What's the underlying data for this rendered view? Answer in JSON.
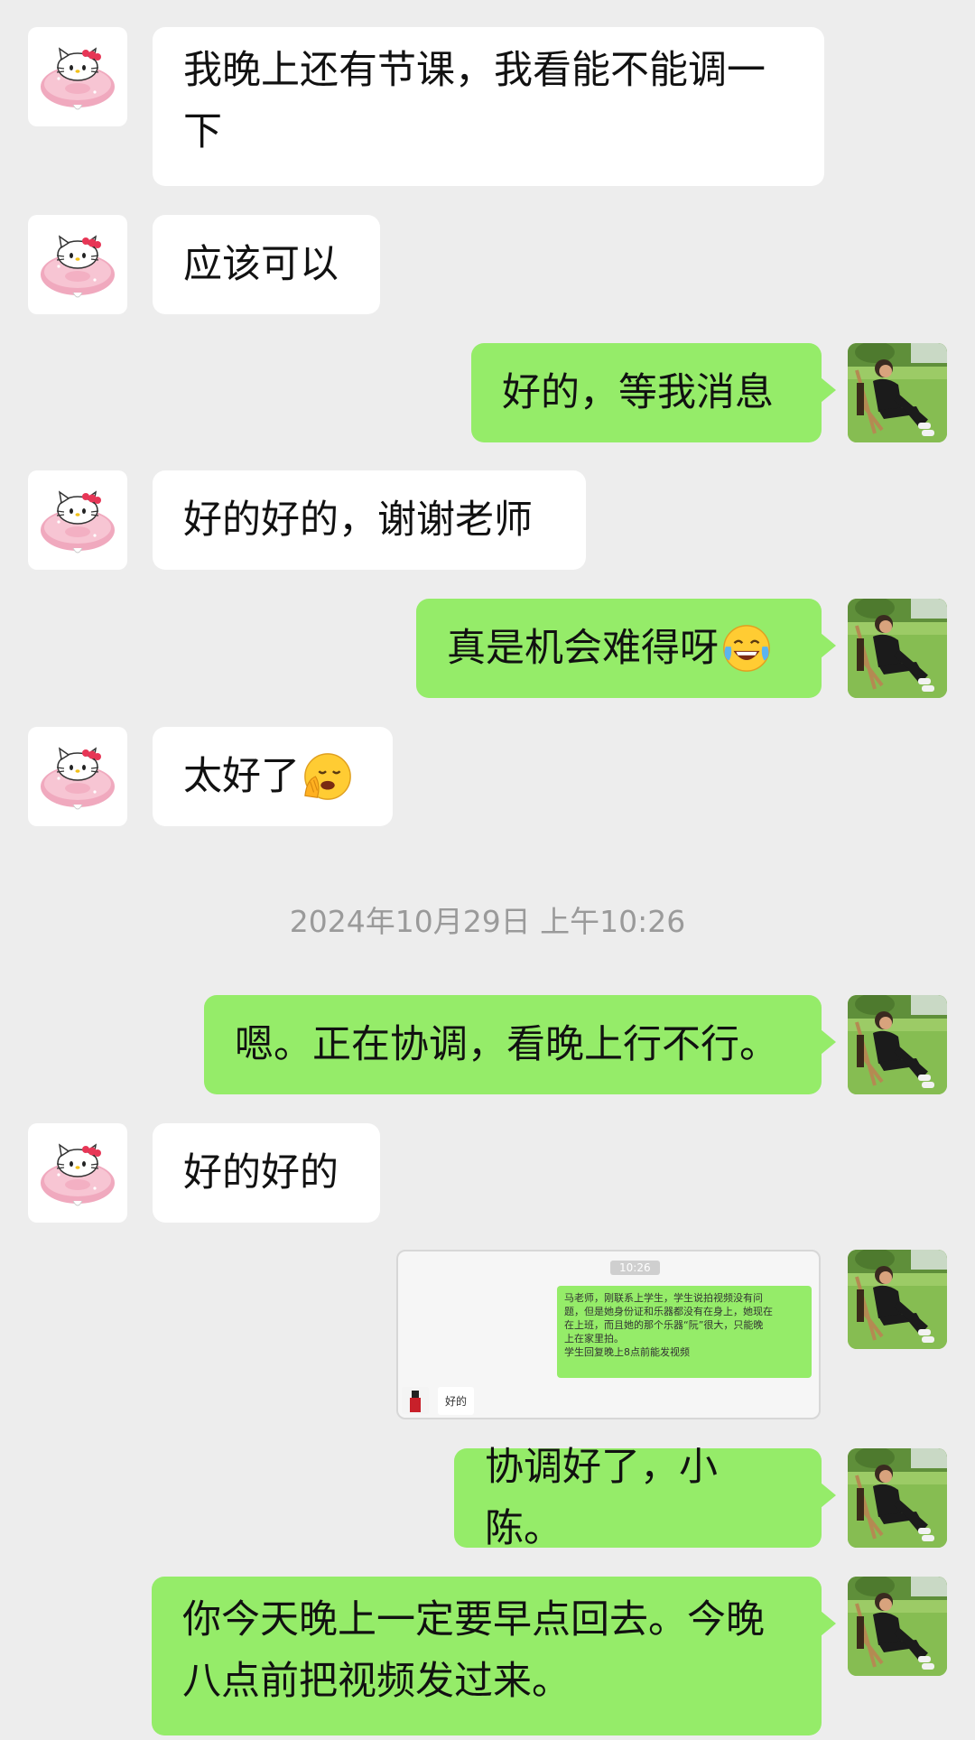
{
  "messages": [
    {
      "side": "left",
      "text_lines": [
        "我晚上还有节课，我看能不能调一",
        "下"
      ]
    },
    {
      "side": "left",
      "text": "应该可以"
    },
    {
      "side": "right",
      "text": "好的，等我消息"
    },
    {
      "side": "left",
      "text": "好的好的，谢谢老师"
    },
    {
      "side": "right",
      "text": "真是机会难得呀",
      "emoji": "tears-of-joy"
    },
    {
      "side": "left",
      "text": "太好了",
      "emoji": "face-in-hand"
    },
    {
      "timestamp": "2024年10月29日 上午10:26"
    },
    {
      "side": "right",
      "text": "嗯。正在协调，看晚上行不行。"
    },
    {
      "side": "left",
      "text": "好的好的"
    },
    {
      "side": "right",
      "type": "image",
      "screenshot": {
        "time": "10:26",
        "lines": [
          "马老师，刚联系上学生，学生说拍视频没有问",
          "题，但是她身份证和乐器都没有在身上，她现在",
          "在上班，而且她的那个乐器“阮”很大，只能晚",
          "上在家里拍。",
          "学生回复晚上8点前能发视频"
        ],
        "reply": "好的"
      }
    },
    {
      "side": "right",
      "text": "协调好了，小陈。"
    },
    {
      "side": "right",
      "text_lines": [
        "你今天晚上一定要早点回去。今晚",
        "八点前把视频发过来。"
      ]
    }
  ],
  "avatars": {
    "left": "hello-kitty-donut-avatar",
    "right": "person-on-lawn-photo-avatar"
  },
  "colors": {
    "background": "#ededed",
    "bubble_left": "#ffffff",
    "bubble_right": "#95ec69",
    "timestamp_text": "#9a9a9a"
  }
}
